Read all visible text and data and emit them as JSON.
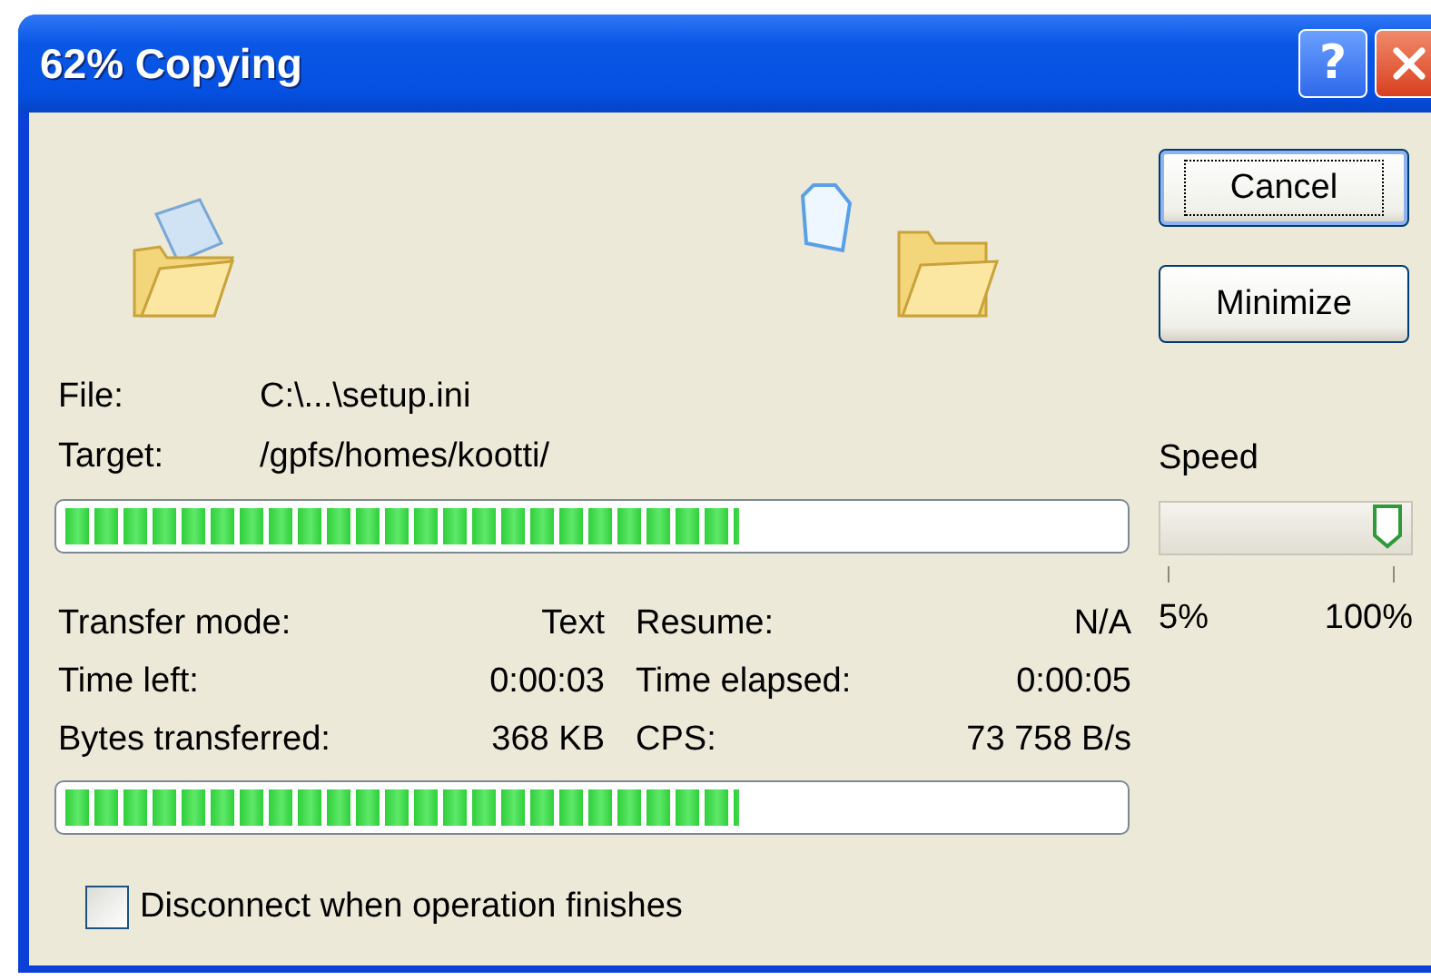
{
  "window": {
    "title": "62% Copying",
    "title_buttons": [
      {
        "kind": "help",
        "text": "?"
      },
      {
        "kind": "close"
      }
    ]
  },
  "buttons": [
    {
      "label": "Cancel",
      "focused": true
    },
    {
      "label": "Minimize",
      "focused": false
    }
  ],
  "details": [
    {
      "label": "File:",
      "value": "C:\\...\\setup.ini"
    },
    {
      "label": "Target:",
      "value": "/gpfs/homes/kootti/"
    }
  ],
  "file_progress": {
    "level": 0.64
  },
  "stats": [
    {
      "label": "Transfer mode:",
      "value": "Text"
    },
    {
      "label": "Resume:",
      "value": "N/A"
    },
    {
      "label": "Time left:",
      "value": "0:00:03"
    },
    {
      "label": "Time elapsed:",
      "value": "0:00:05"
    },
    {
      "label": "Bytes transferred:",
      "value": "368 KB"
    },
    {
      "label": "CPS:",
      "value": "73 758 B/s"
    }
  ],
  "total_progress": {
    "level": 0.64
  },
  "speed": {
    "label": "Speed",
    "level": 1.0,
    "min_label": "5%",
    "max_label": "100%"
  },
  "disconnect_option": {
    "label": "Disconnect when operation finishes",
    "checked": false
  }
}
